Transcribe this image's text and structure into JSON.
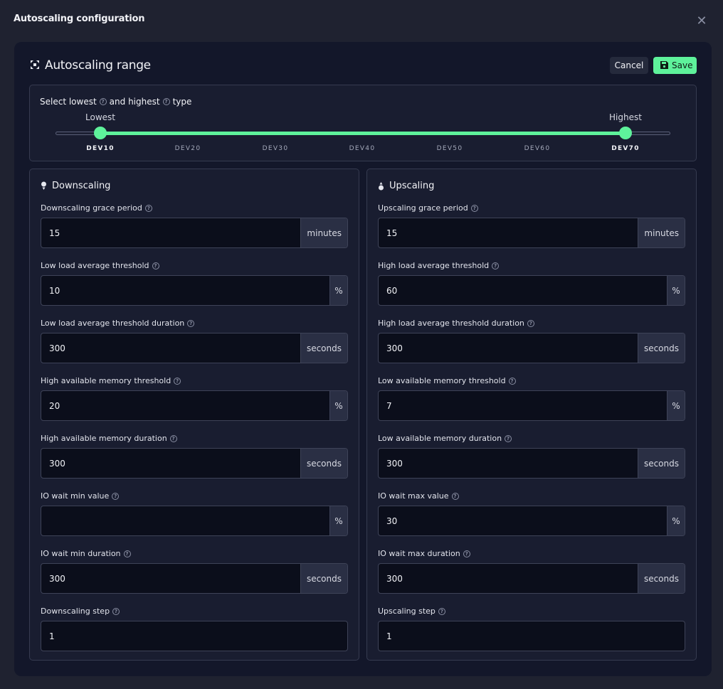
{
  "modal": {
    "title": "Autoscaling configuration",
    "close_label": "✕"
  },
  "panel": {
    "title": "Autoscaling range",
    "cancel_label": "Cancel",
    "save_label": "Save"
  },
  "range": {
    "label_prefix": "Select lowest",
    "label_middle": "and highest",
    "label_suffix": "type",
    "lowest_label": "Lowest",
    "highest_label": "Highest",
    "ticks": [
      "DEV10",
      "DEV20",
      "DEV30",
      "DEV40",
      "DEV50",
      "DEV60",
      "DEV70"
    ],
    "lowest_value": "DEV10",
    "highest_value": "DEV70"
  },
  "colors": {
    "accent": "#5ef29b",
    "panel_bg": "#13172a",
    "input_bg": "#0b0e1b"
  },
  "downscaling": {
    "title": "Downscaling",
    "fields": [
      {
        "label": "Downscaling grace period",
        "value": "15",
        "placeholder": "",
        "suffix": "minutes"
      },
      {
        "label": "Low load average threshold",
        "value": "10",
        "placeholder": "",
        "suffix": "%"
      },
      {
        "label": "Low load average threshold duration",
        "value": "300",
        "placeholder": "",
        "suffix": "seconds"
      },
      {
        "label": "High available memory threshold",
        "value": "20",
        "placeholder": "",
        "suffix": "%"
      },
      {
        "label": "High available memory duration",
        "value": "300",
        "placeholder": "",
        "suffix": "seconds"
      },
      {
        "label": "IO wait min value",
        "value": "",
        "placeholder": "",
        "suffix": "%"
      },
      {
        "label": "IO wait min duration",
        "value": "300",
        "placeholder": "",
        "suffix": "seconds"
      },
      {
        "label": "Downscaling step",
        "value": "1",
        "placeholder": "",
        "suffix": ""
      }
    ]
  },
  "upscaling": {
    "title": "Upscaling",
    "fields": [
      {
        "label": "Upscaling grace period",
        "value": "15",
        "placeholder": "",
        "suffix": "minutes"
      },
      {
        "label": "High load average threshold",
        "value": "60",
        "placeholder": "",
        "suffix": "%"
      },
      {
        "label": "High load average threshold duration",
        "value": "300",
        "placeholder": "",
        "suffix": "seconds"
      },
      {
        "label": "Low available memory threshold",
        "value": "7",
        "placeholder": "",
        "suffix": "%"
      },
      {
        "label": "Low available memory duration",
        "value": "300",
        "placeholder": "",
        "suffix": "seconds"
      },
      {
        "label": "IO wait max value",
        "value": "30",
        "placeholder": "",
        "suffix": "%"
      },
      {
        "label": "IO wait max duration",
        "value": "300",
        "placeholder": "",
        "suffix": "seconds"
      },
      {
        "label": "Upscaling step",
        "value": "1",
        "placeholder": "",
        "suffix": ""
      }
    ]
  }
}
